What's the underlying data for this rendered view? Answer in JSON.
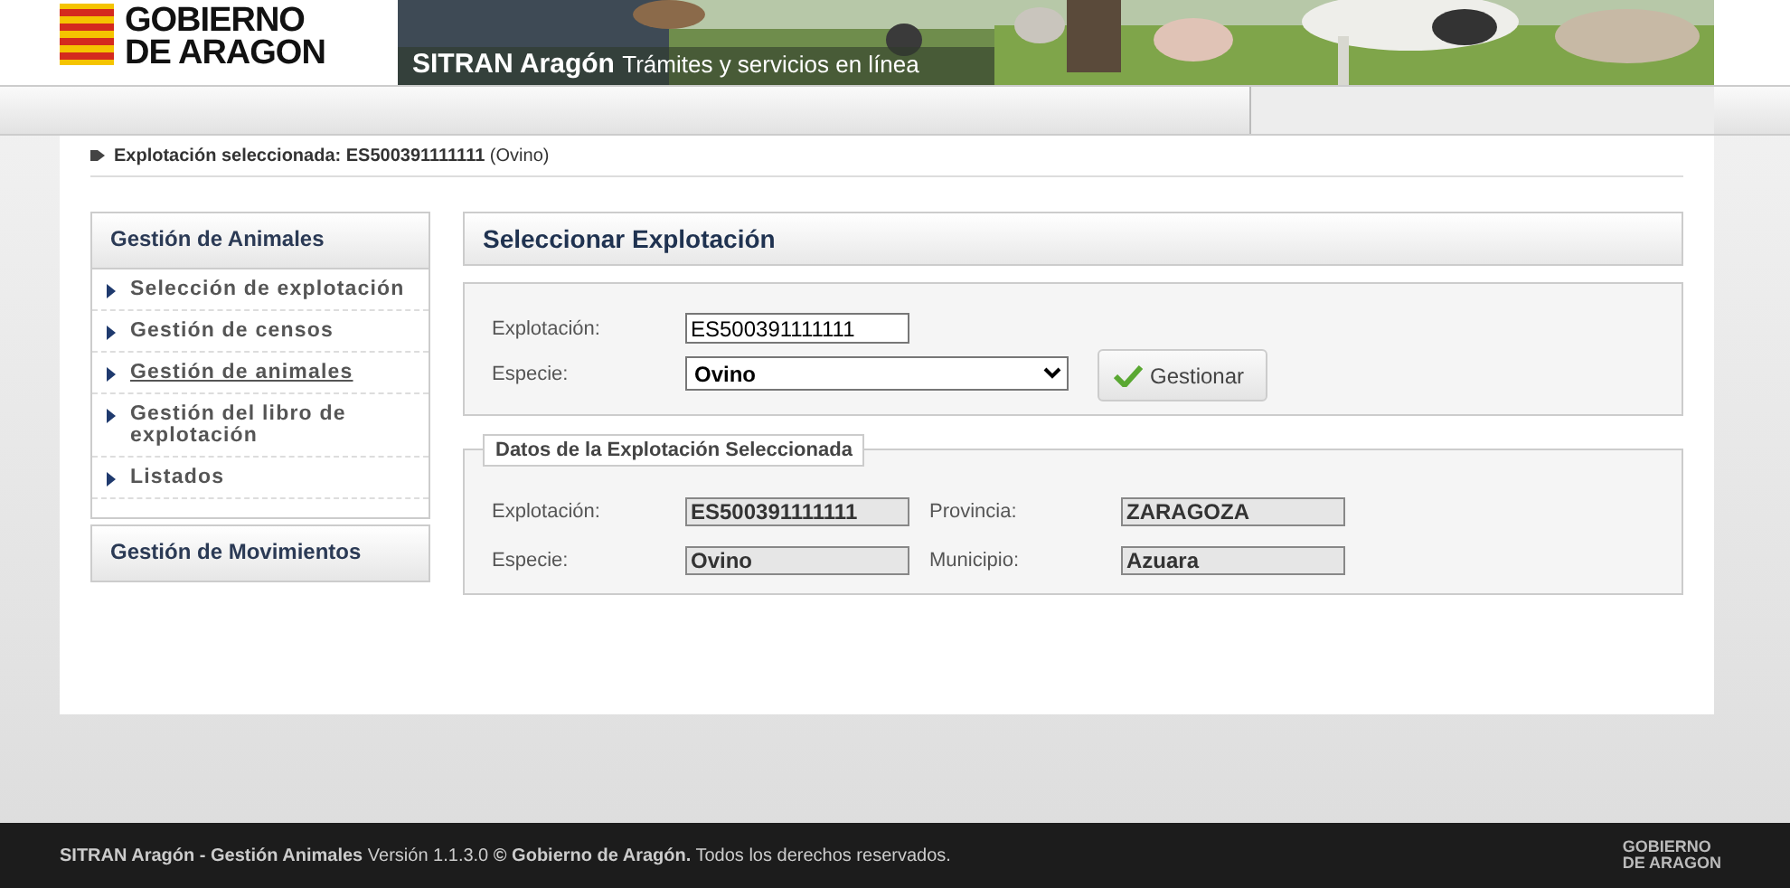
{
  "header": {
    "logo": [
      "GOBIERNO",
      "DE ARAGON"
    ],
    "banner": {
      "kind": "picture",
      "title": "SITRAN Aragón",
      "subtitle": "Trámites y servicios en línea"
    }
  },
  "breadcrumb": {
    "label": "Explotación seleccionada:",
    "code": "ES500391111111",
    "species": "(Ovino)"
  },
  "sidebar": [
    {
      "title": "Gestión de Animales",
      "items": [
        {
          "label": "Selección de explotación",
          "hovered": false
        },
        {
          "label": "Gestión de censos",
          "hovered": false
        },
        {
          "label": "Gestión de animales",
          "hovered": true
        },
        {
          "label": "Gestión del libro de explotación",
          "hovered": false
        },
        {
          "label": "Listados",
          "hovered": false
        }
      ]
    },
    {
      "title": "Gestión de Movimientos"
    }
  ],
  "main": {
    "title": "Seleccionar Explotación",
    "form": {
      "fields": [
        {
          "label": "Explotación:",
          "kind": "input",
          "value": "ES500391111111"
        },
        {
          "label": "Especie:",
          "kind": "select",
          "value": "Ovino"
        }
      ],
      "button": "Gestionar"
    },
    "details": {
      "legend": "Datos de la Explotación Seleccionada",
      "fields": [
        {
          "label": "Explotación:",
          "value": "ES500391111111"
        },
        {
          "label": "Provincia:",
          "value": "ZARAGOZA"
        },
        {
          "label": "Especie:",
          "value": "Ovino"
        },
        {
          "label": "Municipio:",
          "value": "Azuara"
        }
      ]
    }
  },
  "footer": {
    "app": "SITRAN Aragón - Gestión Animales",
    "version": "Versión 1.1.3.0",
    "copyright": "© Gobierno de Aragón.",
    "rights": "Todos los derechos reservados.",
    "logo": [
      "GOBIERNO",
      "DE ARAGON"
    ]
  }
}
